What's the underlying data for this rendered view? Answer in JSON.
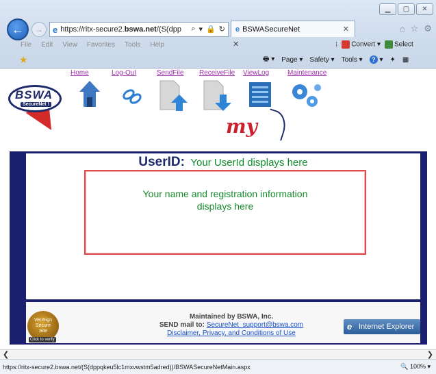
{
  "browser": {
    "address": {
      "prefix": "https://ritx-secure2.",
      "domain": "bswa.net",
      "suffix": "/(S(dpp"
    },
    "address_tools": "ρ ▾ 🔒 C",
    "tab_title": "BSWASecureNet",
    "menu": [
      "File",
      "Edit",
      "View",
      "Favorites",
      "Tools",
      "Help"
    ],
    "addon_convert": "Convert",
    "addon_select": "Select",
    "commands": {
      "page": "Page ▾",
      "safety": "Safety ▾",
      "tools": "Tools ▾"
    },
    "status_url": "https://ritx-secure2.bswa.net/(S(dppqkeu5lc1mxvwstm5adred))/BSWASecureNetMain.aspx",
    "zoom": "100%"
  },
  "site": {
    "logo_text": "BSWA",
    "logo_sub": "SecureNet !",
    "nav": [
      {
        "label": "Home"
      },
      {
        "label": "Log-Out"
      },
      {
        "label": "SendFile"
      },
      {
        "label": "ReceiveFile"
      },
      {
        "label": "ViewLog"
      },
      {
        "label": "Maintenance"
      }
    ],
    "my_logo": "my"
  },
  "main": {
    "userid_label": "UserID:",
    "userid_value": "Your UserId displays here",
    "info_text": "Your name and registration information displays here"
  },
  "footer": {
    "maintained": "Maintained by BSWA, Inc.",
    "send_mail_prefix": "SEND mail to:",
    "email": "SecureNet_support@bswa.com",
    "disclaimer": "Disclaimer, Privacy, and Conditions of Use",
    "verisign_line1": "VeriSign",
    "verisign_line2": "Secure",
    "verisign_line3": "Site",
    "verisign_click": "Click to verify",
    "ie_badge": "Internet Explorer"
  },
  "colors": {
    "frame": "#1c1f6e",
    "userid_label": "#1c2a6a",
    "green_text": "#168a2c",
    "info_border": "#e14a4a",
    "nav_link": "#9a32a8"
  }
}
